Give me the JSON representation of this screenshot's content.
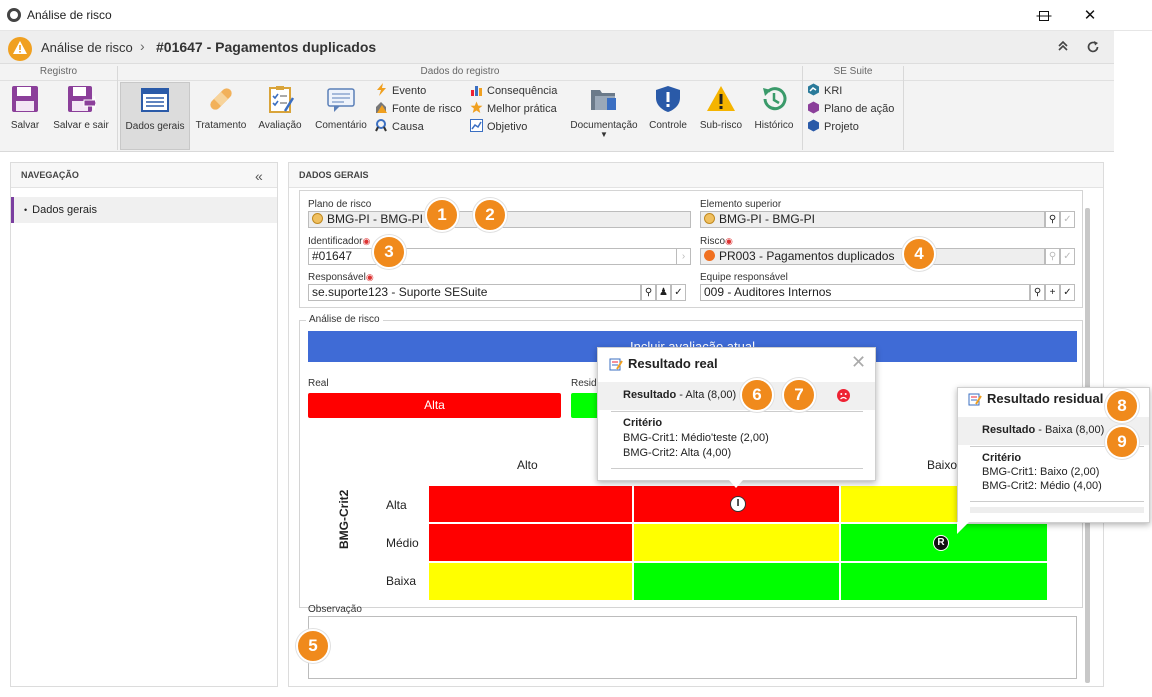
{
  "window": {
    "title": "Análise de risco"
  },
  "header": {
    "breadcrumb_root": "Análise de risco",
    "breadcrumb_sep": "›",
    "record": "#01647 - Pagamentos duplicados"
  },
  "ribbon": {
    "groups": {
      "registro": "Registro",
      "dados": "Dados do registro",
      "suite": "SE Suite"
    },
    "buttons": {
      "salvar": "Salvar",
      "salvar_sair": "Salvar e sair",
      "dados_gerais": "Dados gerais",
      "tratamento": "Tratamento",
      "avaliacao": "Avaliação",
      "comentario": "Comentário",
      "documentacao": "Documentação",
      "controle": "Controle",
      "subrisco": "Sub-risco",
      "historico": "Histórico"
    },
    "small": {
      "evento": "Evento",
      "fonte": "Fonte de risco",
      "causa": "Causa",
      "consequencia": "Consequência",
      "melhor": "Melhor prática",
      "objetivo": "Objetivo",
      "kri": "KRI",
      "plano_acao": "Plano de ação",
      "projeto": "Projeto"
    }
  },
  "nav": {
    "title": "NAVEGAÇÃO",
    "items": [
      {
        "label": "Dados gerais"
      }
    ]
  },
  "main": {
    "title": "DADOS GERAIS",
    "fields": {
      "plano_label": "Plano de risco",
      "plano_value": "BMG-PI - BMG-PI",
      "elemento_label": "Elemento superior",
      "elemento_value": "BMG-PI - BMG-PI",
      "id_label": "Identificador",
      "id_value": "#01647",
      "risco_label": "Risco",
      "risco_value": "PR003 - Pagamentos duplicados",
      "resp_label": "Responsável",
      "resp_value": "se.suporte123 - Suporte SESuite",
      "equipe_label": "Equipe responsável",
      "equipe_value": "009 - Auditores Internos"
    },
    "analise": {
      "title": "Análise de risco",
      "include_button": "Incluir avaliação atual",
      "real_label": "Real",
      "real_value": "Alta",
      "residual_label": "Resid",
      "col_headers": [
        "Alto",
        "",
        "Baixo"
      ],
      "y_axis": "BMG-Crit2",
      "row_headers": [
        "Alta",
        "Médio",
        "Baixa"
      ],
      "marker_real": "I",
      "marker_residual": "R"
    },
    "observacao_label": "Observação"
  },
  "popup_real": {
    "title": "Resultado real",
    "result_label": "Resultado",
    "result_value": " - Alta (8,00)",
    "criteria_title": "Critério",
    "criteria": [
      "BMG-Crit1: Médio'teste (2,00)",
      "BMG-Crit2: Alta (4,00)"
    ]
  },
  "popup_residual": {
    "title": "Resultado residual",
    "result_label": "Resultado",
    "result_value": " - Baixa (8,00)",
    "criteria_title": "Critério",
    "criteria": [
      "BMG-Crit1: Baixo (2,00)",
      "BMG-Crit2: Médio (4,00)"
    ]
  },
  "badges": [
    "1",
    "2",
    "3",
    "4",
    "5",
    "6",
    "7",
    "8",
    "9"
  ],
  "colors": {
    "red": "#ff0000",
    "yellow": "#ffff00",
    "green": "#00ff00",
    "blue": "#3f6bd6",
    "badge": "#f08a1c"
  }
}
